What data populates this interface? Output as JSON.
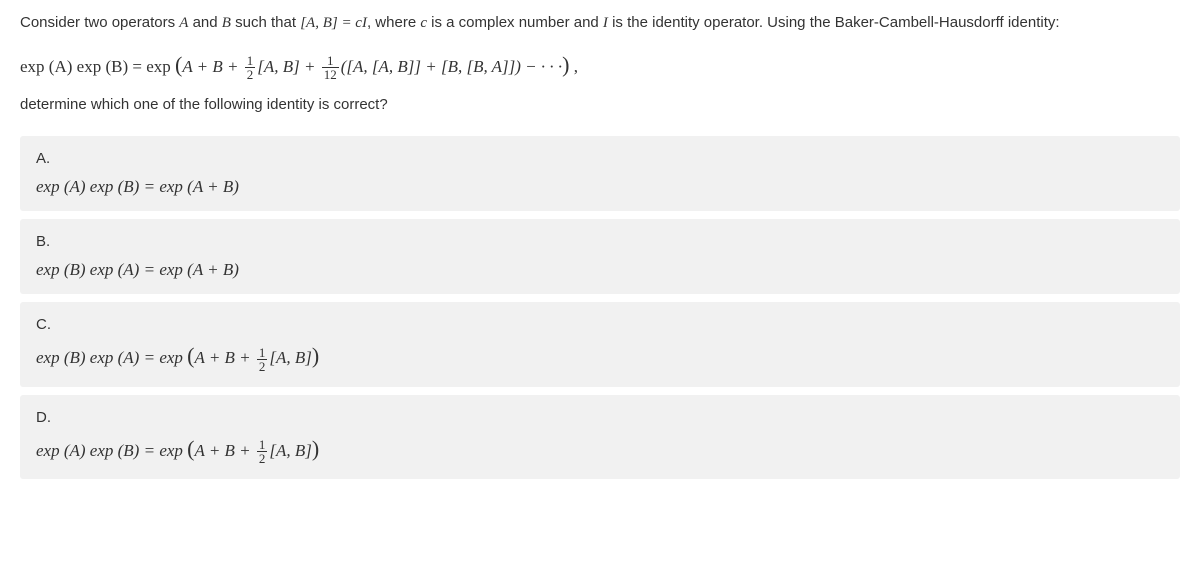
{
  "question": {
    "intro_part1": "Consider two operators ",
    "intro_part2": " and ",
    "intro_part3": " such that ",
    "intro_part4": ", where ",
    "intro_part5": " is a complex number and ",
    "intro_part6": " is the identity operator. Using the Baker-Cambell-Hausdorff identity:",
    "var_A": "A",
    "var_B": "B",
    "var_c": "c",
    "var_I": "I",
    "commutator": "[A, B] = cI",
    "ask": "determine which one of the following identity is correct?"
  },
  "main_formula": {
    "lhs": "exp (A) exp (B) = exp ",
    "open": "(",
    "term1": "A + B + ",
    "frac1_num": "1",
    "frac1_den": "2",
    "term2": "[A, B] + ",
    "frac2_num": "1",
    "frac2_den": "12",
    "term3": "([A, [A, B]] + [B, [B, A]]) − · · ·",
    "close": ")",
    "tail": " ,"
  },
  "options": [
    {
      "label": "A.",
      "formula": "exp (A) exp (B) = exp (A + B)",
      "has_frac": false
    },
    {
      "label": "B.",
      "formula": "exp (B) exp (A) = exp (A + B)",
      "has_frac": false
    },
    {
      "label": "C.",
      "formula_pre": "exp (B) exp (A) = exp ",
      "open": "(",
      "term": "A + B + ",
      "frac_num": "1",
      "frac_den": "2",
      "term_end": "[A, B]",
      "close": ")",
      "has_frac": true
    },
    {
      "label": "D.",
      "formula_pre": "exp (A) exp (B) = exp ",
      "open": "(",
      "term": "A + B + ",
      "frac_num": "1",
      "frac_den": "2",
      "term_end": "[A, B]",
      "close": ")",
      "has_frac": true
    }
  ]
}
